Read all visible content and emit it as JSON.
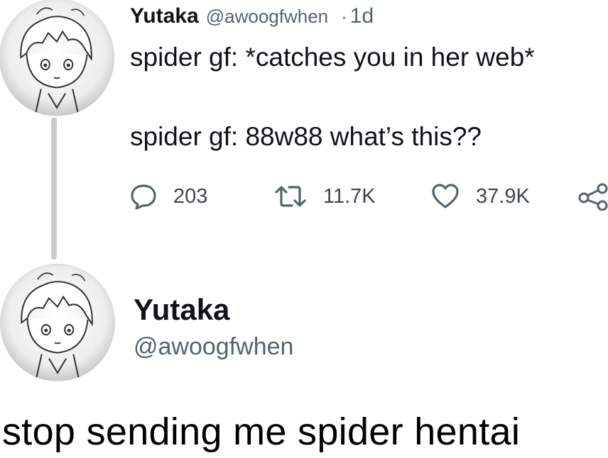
{
  "tweet": {
    "author_name": "Yutaka",
    "author_handle": "@awoogfwhen",
    "separator": "·",
    "time": "1d",
    "lines": [
      "spider gf: *catches you in her web*",
      "spider gf: 88w88 what’s this??"
    ],
    "actions": {
      "reply": {
        "icon": "speech-bubble-icon",
        "count": "203"
      },
      "retweet": {
        "icon": "retweet-icon",
        "count": "11.7K"
      },
      "like": {
        "icon": "heart-icon",
        "count": "37.9K"
      },
      "share": {
        "icon": "share-icon"
      }
    }
  },
  "reply": {
    "author_name": "Yutaka",
    "author_handle": "@awoogfwhen",
    "text": "stop sending me spider hentai"
  },
  "colors": {
    "text": "#0f1419",
    "secondary": "#536471",
    "thread_line": "#c9ccd0"
  }
}
